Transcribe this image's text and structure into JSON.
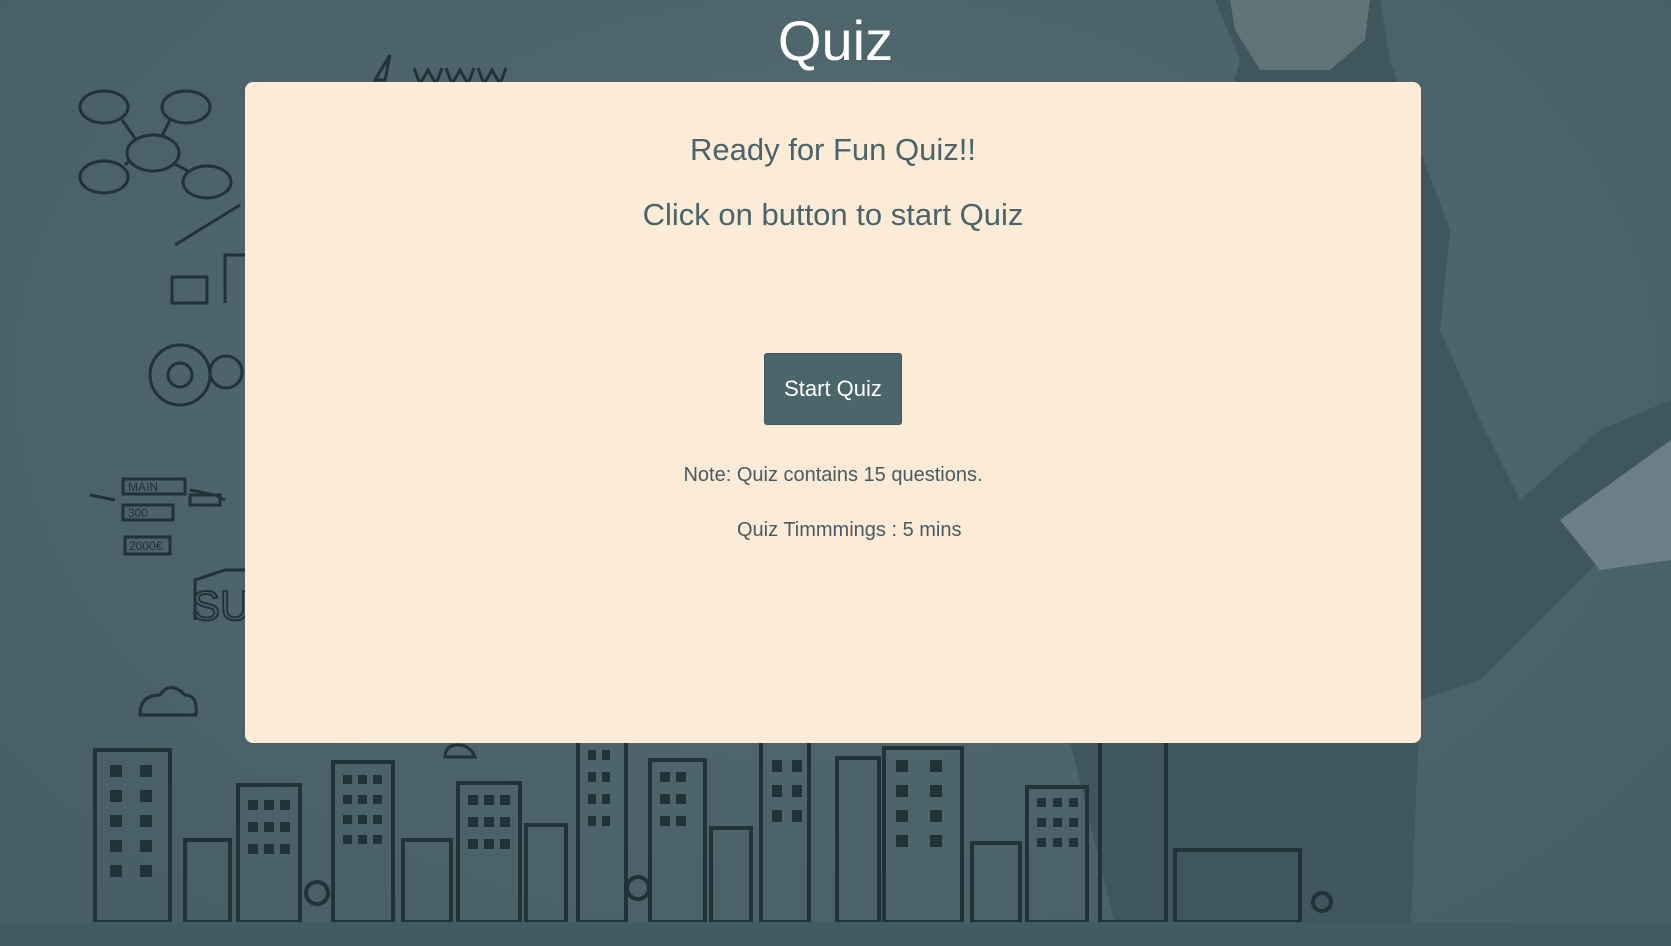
{
  "page": {
    "title": "Quiz"
  },
  "card": {
    "heading": "Ready for Fun Quiz!!",
    "subheading": "Click on button to start Quiz",
    "start_button_label": "Start Quiz",
    "note": "Note: Quiz contains 15 questions.",
    "timing": "Quiz Timmmings : 5 mins"
  },
  "background": {
    "sketch_labels": [
      "www",
      "MAIN",
      "300",
      "2000€",
      "SUC"
    ]
  },
  "colors": {
    "background": "#4a6168",
    "card": "#fbebd7",
    "button": "#4a666b",
    "heading_text": "#4a6469"
  }
}
